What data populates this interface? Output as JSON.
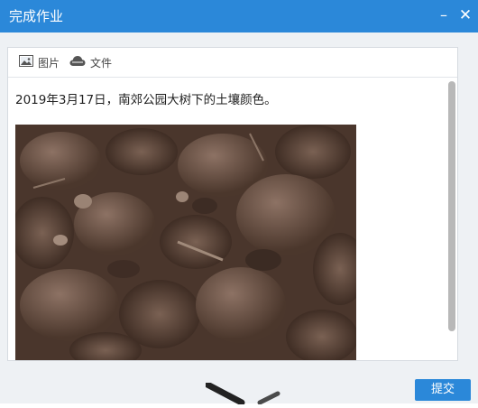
{
  "window": {
    "title": "完成作业",
    "minimize_symbol": "–",
    "close_symbol": "✕"
  },
  "toolbar": {
    "image_label": "图片",
    "image_icon": "image-icon",
    "file_label": "文件",
    "file_icon": "cloud-file-icon"
  },
  "content": {
    "text": "2019年3月17日，南郊公园大树下的土壤颜色。",
    "image_description_icon": "soil-photo"
  },
  "actions": {
    "submit_label": "提交"
  },
  "colors": {
    "accent": "#2b88d9",
    "soil": "#5a4537"
  }
}
